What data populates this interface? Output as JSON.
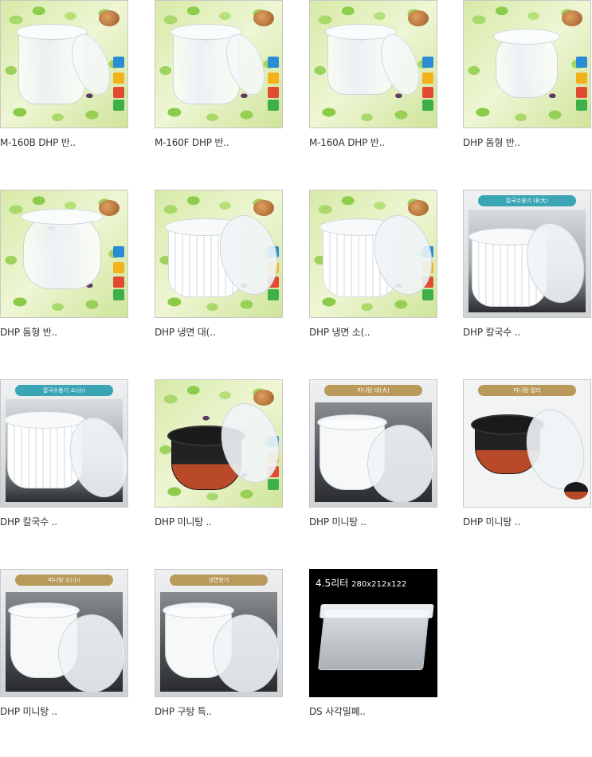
{
  "products": [
    {
      "caption": "M-160B DHP 반..",
      "style": "leaf-clear-cup"
    },
    {
      "caption": "M-160F DHP 반..",
      "style": "leaf-clear-cup"
    },
    {
      "caption": "M-160A DHP 반..",
      "style": "leaf-clear-cup"
    },
    {
      "caption": "DHP 돔형 반..",
      "style": "leaf-dome"
    },
    {
      "caption": "DHP 돔형 반..",
      "style": "leaf-dome"
    },
    {
      "caption": "DHP 냉면 대(..",
      "style": "leaf-ribbed"
    },
    {
      "caption": "DHP 냉면 소(..",
      "style": "leaf-ribbed"
    },
    {
      "caption": "DHP 칼국수 ..",
      "style": "studio-ribbed",
      "banner": "칼국수용기 대(大)"
    },
    {
      "caption": "DHP 칼국수 ..",
      "style": "studio-ribbed",
      "banner": "칼국수용기 소(小)"
    },
    {
      "caption": "DHP 미니탕 ..",
      "style": "leaf-black"
    },
    {
      "caption": "DHP 미니탕 ..",
      "style": "studio-white-bowl",
      "banner": "미니탕 대(大)"
    },
    {
      "caption": "DHP 미니탕 ..",
      "style": "studio-black-bowl",
      "banner": "미니탕 칼라"
    },
    {
      "caption": "DHP 미니탕 ..",
      "style": "studio-white-bowl",
      "banner": "미니탕 소(小)"
    },
    {
      "caption": "DHP 구탕 특..",
      "style": "studio-white-bowl",
      "banner": "냉면용기"
    },
    {
      "caption": "DS 사각밀폐..",
      "style": "black-box",
      "photo_title": "4.5리터",
      "photo_dims": "280x212x122"
    }
  ]
}
